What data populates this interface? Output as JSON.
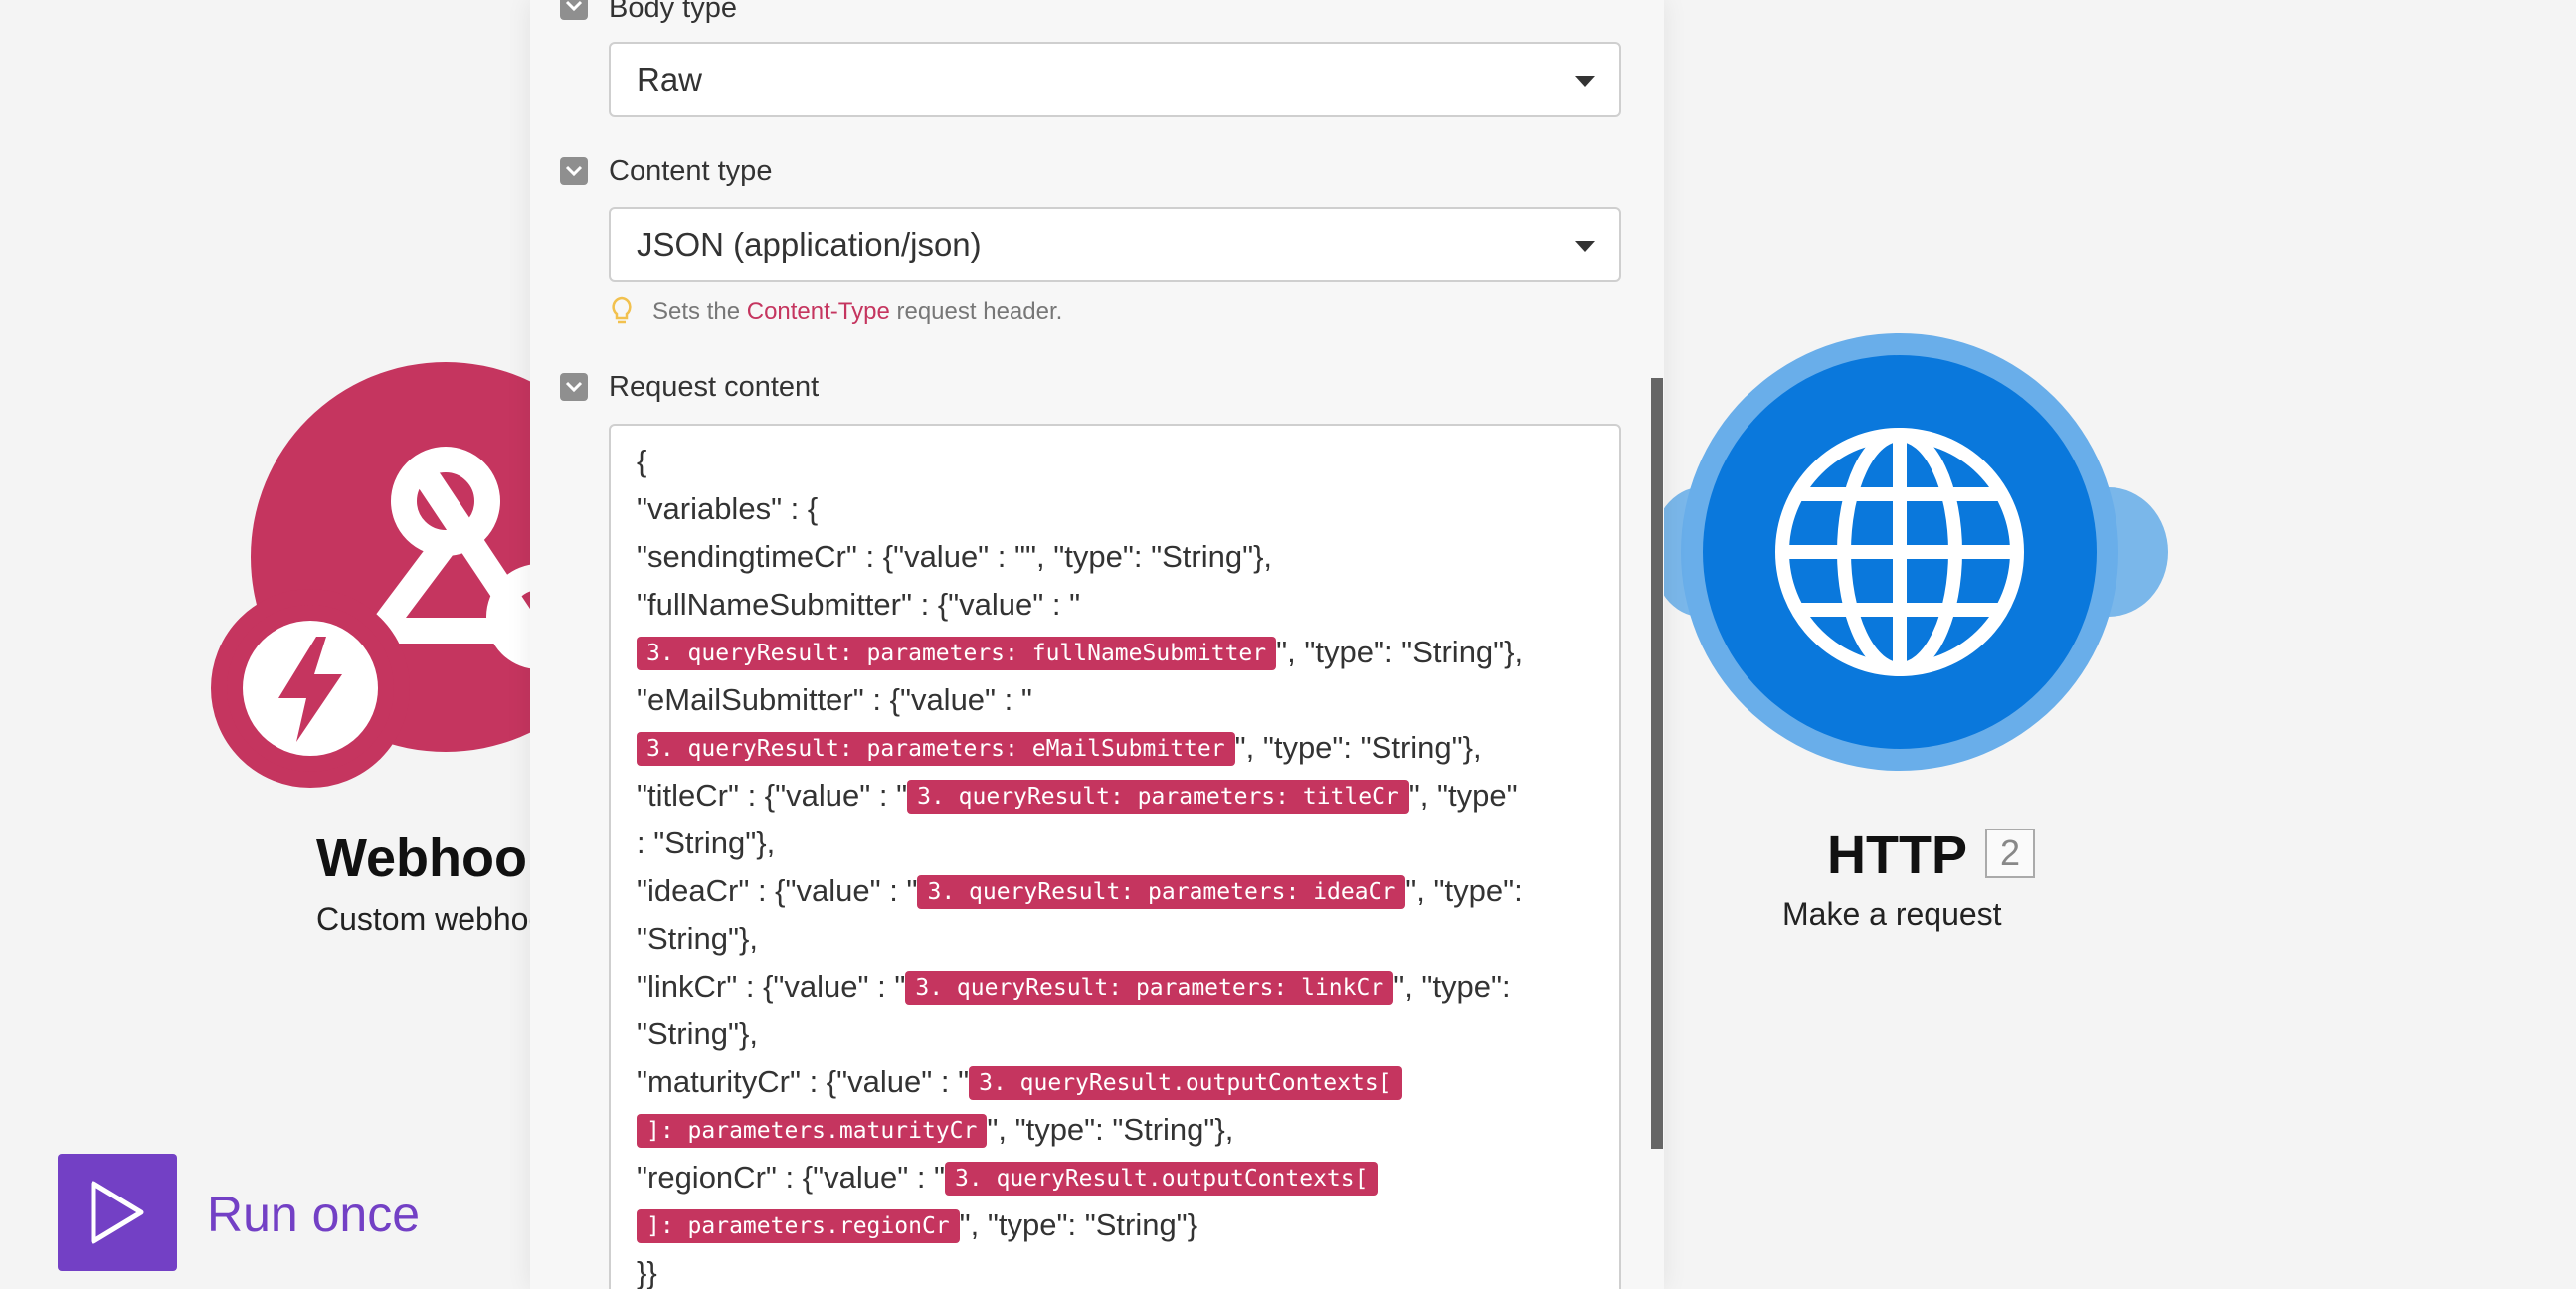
{
  "canvas": {
    "webhook": {
      "title": "Webhooks",
      "subtitle": "Custom webhook",
      "icon": "webhook-icon"
    },
    "http": {
      "title": "HTTP",
      "id": "2",
      "subtitle": "Make a request",
      "icon": "globe-icon"
    },
    "run_once": {
      "label": "Run once",
      "icon": "play-icon"
    }
  },
  "panel": {
    "body_type": {
      "label": "Body type",
      "value": "Raw"
    },
    "content_type": {
      "label": "Content type",
      "value": "JSON (application/json)",
      "hint_prefix": "Sets the ",
      "hint_link": "Content-Type",
      "hint_suffix": " request header."
    },
    "request_content": {
      "label": "Request content",
      "lines": [
        {
          "t1": "{"
        },
        {
          "t1": "\"variables\" : {"
        },
        {
          "t1": "\"sendingtimeCr\" : {\"value\" : \"\", \"type\": \"String\"},"
        },
        {
          "t1": "\"fullNameSubmitter\" : {\"value\" : \""
        },
        {
          "p1": "3. queryResult: parameters: fullNameSubmitter",
          "t2": "\", \"type\": \"String\"},"
        },
        {
          "t1": "\"eMailSubmitter\" : {\"value\" : \""
        },
        {
          "p1": "3. queryResult: parameters: eMailSubmitter",
          "t2": "\", \"type\": \"String\"},"
        },
        {
          "t1": "\"titleCr\" : {\"value\" : \"",
          "p1": "3. queryResult: parameters: titleCr",
          "t2": "\", \"type\""
        },
        {
          "t1": ": \"String\"},"
        },
        {
          "t1": "\"ideaCr\" : {\"value\" : \"",
          "p1": "3. queryResult: parameters: ideaCr",
          "t2": "\", \"type\":"
        },
        {
          "t1": "\"String\"},"
        },
        {
          "t1": "\"linkCr\" : {\"value\" : \"",
          "p1": "3. queryResult: parameters: linkCr",
          "t2": "\", \"type\":"
        },
        {
          "t1": "\"String\"},"
        },
        {
          "t1": "\"maturityCr\" : {\"value\" : \"",
          "p1": "3. queryResult.outputContexts["
        },
        {
          "p1": "]: parameters.maturityCr",
          "t2": "\", \"type\": \"String\"},"
        },
        {
          "t1": "\"regionCr\" : {\"value\" : \"",
          "p1": "3. queryResult.outputContexts["
        },
        {
          "p1": "]: parameters.regionCr",
          "t2": "\", \"type\": \"String\"}"
        },
        {
          "t1": "}}"
        }
      ]
    }
  },
  "colors": {
    "webhook": "#c5355f",
    "http": "#0a78dc",
    "accent": "#7340c5",
    "pill": "#c5355f"
  }
}
